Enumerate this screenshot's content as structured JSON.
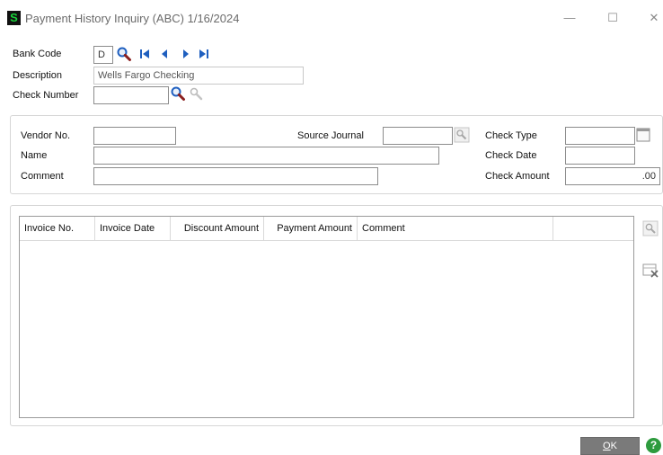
{
  "window": {
    "title": "Payment History Inquiry (ABC) 1/16/2024",
    "app_icon_letter": "S",
    "minimize": "—",
    "maximize": "☐",
    "close": "✕"
  },
  "header": {
    "bank_code_label": "Bank Code",
    "bank_code_value": "D",
    "description_label": "Description",
    "description_value": "Wells Fargo Checking",
    "check_number_label": "Check Number",
    "check_number_value": ""
  },
  "check_info": {
    "vendor_no_label": "Vendor No.",
    "vendor_no_value": "",
    "name_label": "Name",
    "name_value": "",
    "comment_label": "Comment",
    "comment_value": "",
    "source_journal_label": "Source Journal",
    "source_journal_value": "",
    "check_type_label": "Check Type",
    "check_type_value": "",
    "check_date_label": "Check Date",
    "check_date_value": "",
    "check_amount_label": "Check Amount",
    "check_amount_value": ".00"
  },
  "grid": {
    "columns": [
      "Invoice No.",
      "Invoice Date",
      "Discount Amount",
      "Payment Amount",
      "Comment"
    ],
    "rows": []
  },
  "footer": {
    "ok_mnemonic": "O",
    "ok_rest": "K",
    "help": "?"
  },
  "colors": {
    "accent_blue": "#1f5fbf",
    "help_green": "#2e9b3e",
    "ok_gray": "#7a7a7a"
  },
  "icons": [
    "search-icon",
    "first-record-icon",
    "previous-record-icon",
    "next-record-icon",
    "last-record-icon",
    "lookup-icon",
    "calendar-icon",
    "grid-lookup-icon",
    "grid-delete-icon"
  ]
}
